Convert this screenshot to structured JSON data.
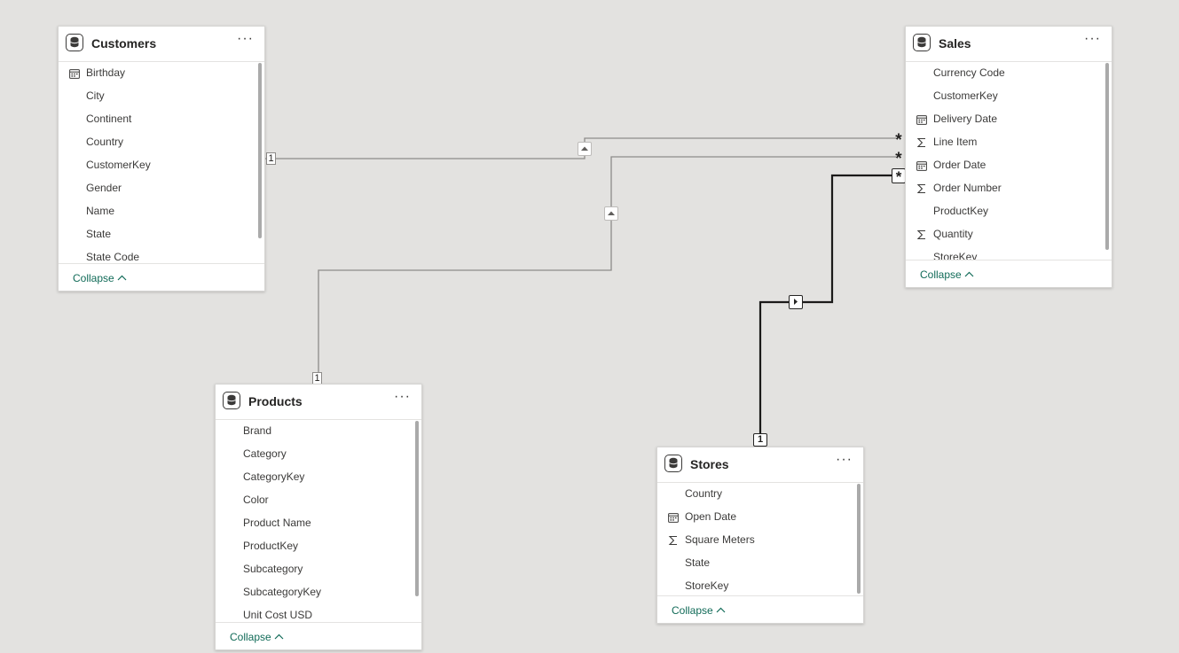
{
  "tables": {
    "customers": {
      "title": "Customers",
      "fields": [
        {
          "name": "Birthday",
          "icon": "calendar-icon"
        },
        {
          "name": "City",
          "icon": ""
        },
        {
          "name": "Continent",
          "icon": ""
        },
        {
          "name": "Country",
          "icon": ""
        },
        {
          "name": "CustomerKey",
          "icon": ""
        },
        {
          "name": "Gender",
          "icon": ""
        },
        {
          "name": "Name",
          "icon": ""
        },
        {
          "name": "State",
          "icon": ""
        },
        {
          "name": "State Code",
          "icon": ""
        }
      ],
      "collapse_label": "Collapse"
    },
    "sales": {
      "title": "Sales",
      "fields": [
        {
          "name": "Currency Code",
          "icon": ""
        },
        {
          "name": "CustomerKey",
          "icon": ""
        },
        {
          "name": "Delivery Date",
          "icon": "calendar-icon"
        },
        {
          "name": "Line Item",
          "icon": "sum-icon"
        },
        {
          "name": "Order Date",
          "icon": "calendar-icon"
        },
        {
          "name": "Order Number",
          "icon": "sum-icon"
        },
        {
          "name": "ProductKey",
          "icon": ""
        },
        {
          "name": "Quantity",
          "icon": "sum-icon"
        },
        {
          "name": "StoreKey",
          "icon": ""
        }
      ],
      "collapse_label": "Collapse"
    },
    "products": {
      "title": "Products",
      "fields": [
        {
          "name": "Brand",
          "icon": ""
        },
        {
          "name": "Category",
          "icon": ""
        },
        {
          "name": "CategoryKey",
          "icon": ""
        },
        {
          "name": "Color",
          "icon": ""
        },
        {
          "name": "Product Name",
          "icon": ""
        },
        {
          "name": "ProductKey",
          "icon": ""
        },
        {
          "name": "Subcategory",
          "icon": ""
        },
        {
          "name": "SubcategoryKey",
          "icon": ""
        },
        {
          "name": "Unit Cost USD",
          "icon": ""
        }
      ],
      "collapse_label": "Collapse"
    },
    "stores": {
      "title": "Stores",
      "fields": [
        {
          "name": "Country",
          "icon": ""
        },
        {
          "name": "Open Date",
          "icon": "calendar-icon"
        },
        {
          "name": "Square Meters",
          "icon": "sum-icon"
        },
        {
          "name": "State",
          "icon": ""
        },
        {
          "name": "StoreKey",
          "icon": ""
        }
      ],
      "collapse_label": "Collapse"
    }
  },
  "relationships": {
    "customers_sales": {
      "one_label": "1",
      "many_label": "*"
    },
    "products_sales": {
      "one_label": "1",
      "many_label": "*"
    },
    "stores_sales": {
      "one_label": "1",
      "many_label": "*"
    }
  },
  "more_label": "···",
  "colors": {
    "canvas": "#e3e2e0",
    "card": "#ffffff",
    "link": "#116b58",
    "line": "#8d8b89",
    "active_line": "#252423"
  }
}
